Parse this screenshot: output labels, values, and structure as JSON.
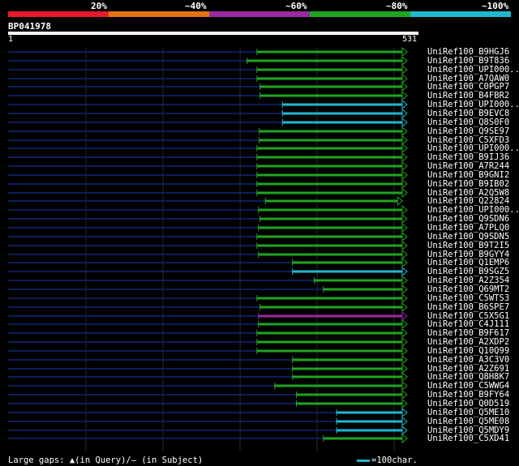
{
  "legend": [
    {
      "label": "20%",
      "color": "#e8192c"
    },
    {
      "label": "~40%",
      "color": "#e57316"
    },
    {
      "label": "~60%",
      "color": "#9a2aa0"
    },
    {
      "label": "~80%",
      "color": "#1fa51f"
    },
    {
      "label": "~100%",
      "color": "#1fb8cf"
    }
  ],
  "query": {
    "name": "BP041978",
    "start": "1",
    "end": "531",
    "length": 531
  },
  "hits": [
    {
      "name": "UniRef100_B9HGJ6",
      "start": 322,
      "end": 510,
      "color": "#1fa51f"
    },
    {
      "name": "UniRef100_B9T836",
      "start": 309,
      "end": 510,
      "color": "#1fa51f"
    },
    {
      "name": "UniRef100_UPI000..",
      "start": 322,
      "end": 510,
      "color": "#1fa51f"
    },
    {
      "name": "UniRef100_A7QAW0",
      "start": 322,
      "end": 510,
      "color": "#1fa51f"
    },
    {
      "name": "UniRef100_C0PGP7",
      "start": 326,
      "end": 510,
      "color": "#1fa51f"
    },
    {
      "name": "UniRef100_B4FBR2",
      "start": 326,
      "end": 510,
      "color": "#1fa51f"
    },
    {
      "name": "UniRef100_UPI000..",
      "start": 355,
      "end": 510,
      "color": "#1fb8cf"
    },
    {
      "name": "UniRef100_B9EVC8",
      "start": 355,
      "end": 510,
      "color": "#1fb8cf"
    },
    {
      "name": "UniRef100_Q8S0F0",
      "start": 355,
      "end": 510,
      "color": "#1fb8cf"
    },
    {
      "name": "UniRef100_Q9SE97",
      "start": 325,
      "end": 510,
      "color": "#1fa51f"
    },
    {
      "name": "UniRef100_C5XFD3",
      "start": 325,
      "end": 510,
      "color": "#1fa51f"
    },
    {
      "name": "UniRef100_UPI000..",
      "start": 322,
      "end": 510,
      "color": "#1fa51f"
    },
    {
      "name": "UniRef100_B9IJ36",
      "start": 322,
      "end": 510,
      "color": "#1fa51f"
    },
    {
      "name": "UniRef100_A7R244",
      "start": 322,
      "end": 510,
      "color": "#1fa51f"
    },
    {
      "name": "UniRef100_B9GNI2",
      "start": 322,
      "end": 510,
      "color": "#1fa51f"
    },
    {
      "name": "UniRef100_B9IB02",
      "start": 322,
      "end": 510,
      "color": "#1fa51f"
    },
    {
      "name": "UniRef100_A2Q5W8",
      "start": 322,
      "end": 510,
      "color": "#1fa51f"
    },
    {
      "name": "UniRef100_Q22824",
      "start": 333,
      "end": 504,
      "color": "#1fa51f"
    },
    {
      "name": "UniRef100_UPI000..",
      "start": 324,
      "end": 510,
      "color": "#1fa51f"
    },
    {
      "name": "UniRef100_Q9SDN6",
      "start": 326,
      "end": 510,
      "color": "#1fa51f"
    },
    {
      "name": "UniRef100_A7PLQ0",
      "start": 324,
      "end": 510,
      "color": "#1fa51f"
    },
    {
      "name": "UniRef100_Q9SDN5",
      "start": 322,
      "end": 510,
      "color": "#1fa51f"
    },
    {
      "name": "UniRef100_B9T2I5",
      "start": 322,
      "end": 510,
      "color": "#1fa51f"
    },
    {
      "name": "UniRef100_B9GYY4",
      "start": 324,
      "end": 510,
      "color": "#1fa51f"
    },
    {
      "name": "UniRef100_Q1EMP6",
      "start": 368,
      "end": 510,
      "color": "#1fa51f"
    },
    {
      "name": "UniRef100_B9SGZ5",
      "start": 368,
      "end": 510,
      "color": "#1fb8cf"
    },
    {
      "name": "UniRef100_A2Z354",
      "start": 396,
      "end": 510,
      "color": "#1fa51f"
    },
    {
      "name": "UniRef100_Q69MT2",
      "start": 408,
      "end": 510,
      "color": "#1fa51f"
    },
    {
      "name": "UniRef100_C5WTS3",
      "start": 322,
      "end": 510,
      "color": "#1fa51f"
    },
    {
      "name": "UniRef100_B6SPE7",
      "start": 326,
      "end": 510,
      "color": "#1fa51f"
    },
    {
      "name": "UniRef100_C5X5G1",
      "start": 324,
      "end": 510,
      "color": "#9a2aa0"
    },
    {
      "name": "UniRef100_C4J111",
      "start": 324,
      "end": 510,
      "color": "#1fa51f"
    },
    {
      "name": "UniRef100_B9F617",
      "start": 322,
      "end": 510,
      "color": "#1fa51f"
    },
    {
      "name": "UniRef100_A2XDP2",
      "start": 322,
      "end": 510,
      "color": "#1fa51f"
    },
    {
      "name": "UniRef100_Q10Q99",
      "start": 322,
      "end": 510,
      "color": "#1fa51f"
    },
    {
      "name": "UniRef100_A3C3V0",
      "start": 368,
      "end": 510,
      "color": "#1fa51f"
    },
    {
      "name": "UniRef100_A2Z691",
      "start": 368,
      "end": 510,
      "color": "#1fa51f"
    },
    {
      "name": "UniRef100_Q8H8K7",
      "start": 368,
      "end": 510,
      "color": "#1fa51f"
    },
    {
      "name": "UniRef100_C5WWG4",
      "start": 345,
      "end": 510,
      "color": "#1fa51f"
    },
    {
      "name": "UniRef100_B9FY64",
      "start": 373,
      "end": 510,
      "color": "#1fa51f"
    },
    {
      "name": "UniRef100_Q0D519",
      "start": 373,
      "end": 510,
      "color": "#1fa51f"
    },
    {
      "name": "UniRef100_Q5ME10",
      "start": 425,
      "end": 510,
      "color": "#1fb8cf"
    },
    {
      "name": "UniRef100_Q5ME08",
      "start": 425,
      "end": 510,
      "color": "#1fb8cf"
    },
    {
      "name": "UniRef100_Q5MDY9",
      "start": 425,
      "end": 510,
      "color": "#1fb8cf"
    },
    {
      "name": "UniRef100_C5XD41",
      "start": 408,
      "end": 510,
      "color": "#1fa51f"
    }
  ],
  "footer": {
    "gaps_label": "Large gaps: ▲(in Query)/– (in Subject)",
    "scale_label": "=100char."
  }
}
